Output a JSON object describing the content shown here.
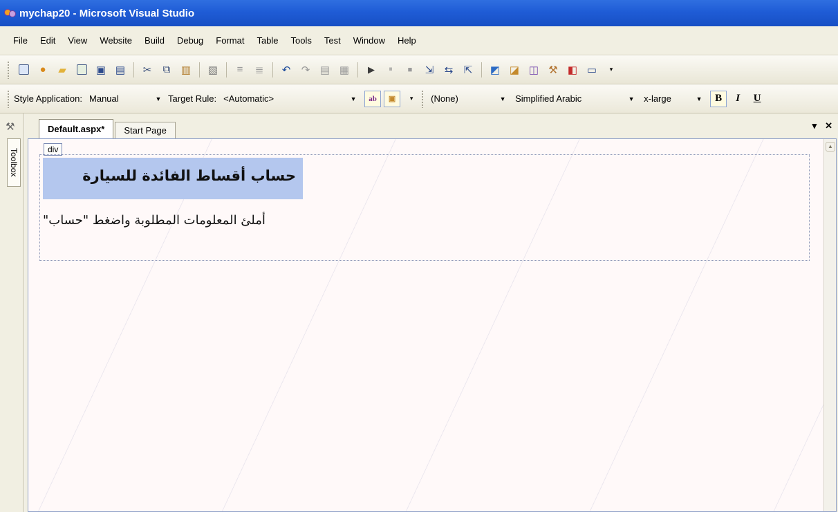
{
  "window": {
    "title": "mychap20 - Microsoft Visual Studio"
  },
  "menu": [
    "File",
    "Edit",
    "View",
    "Website",
    "Build",
    "Debug",
    "Format",
    "Table",
    "Tools",
    "Test",
    "Window",
    "Help"
  ],
  "style_toolbar": {
    "style_app_label": "Style Application:",
    "style_app_value": "Manual",
    "target_rule_label": "Target Rule:",
    "target_rule_value": "<Automatic>",
    "block_format": "(None)",
    "font_name": "Simplified Arabic",
    "font_size": "x-large",
    "bold": "B",
    "italic": "I",
    "underline": "U"
  },
  "toolbox": {
    "label": "Toolbox"
  },
  "tabs": [
    {
      "label": "Default.aspx*",
      "active": true
    },
    {
      "label": "Start Page",
      "active": false
    }
  ],
  "designer": {
    "tag_label": "div",
    "heading": "حساب أقساط الفائدة للسيارة",
    "subtitle": "أملئ المعلومات المطلوبة واضغط \"حساب\""
  },
  "colors": {
    "titlebar": "#1f5cd6",
    "selection": "#b4c7ee",
    "canvas": "#fff9f9"
  }
}
